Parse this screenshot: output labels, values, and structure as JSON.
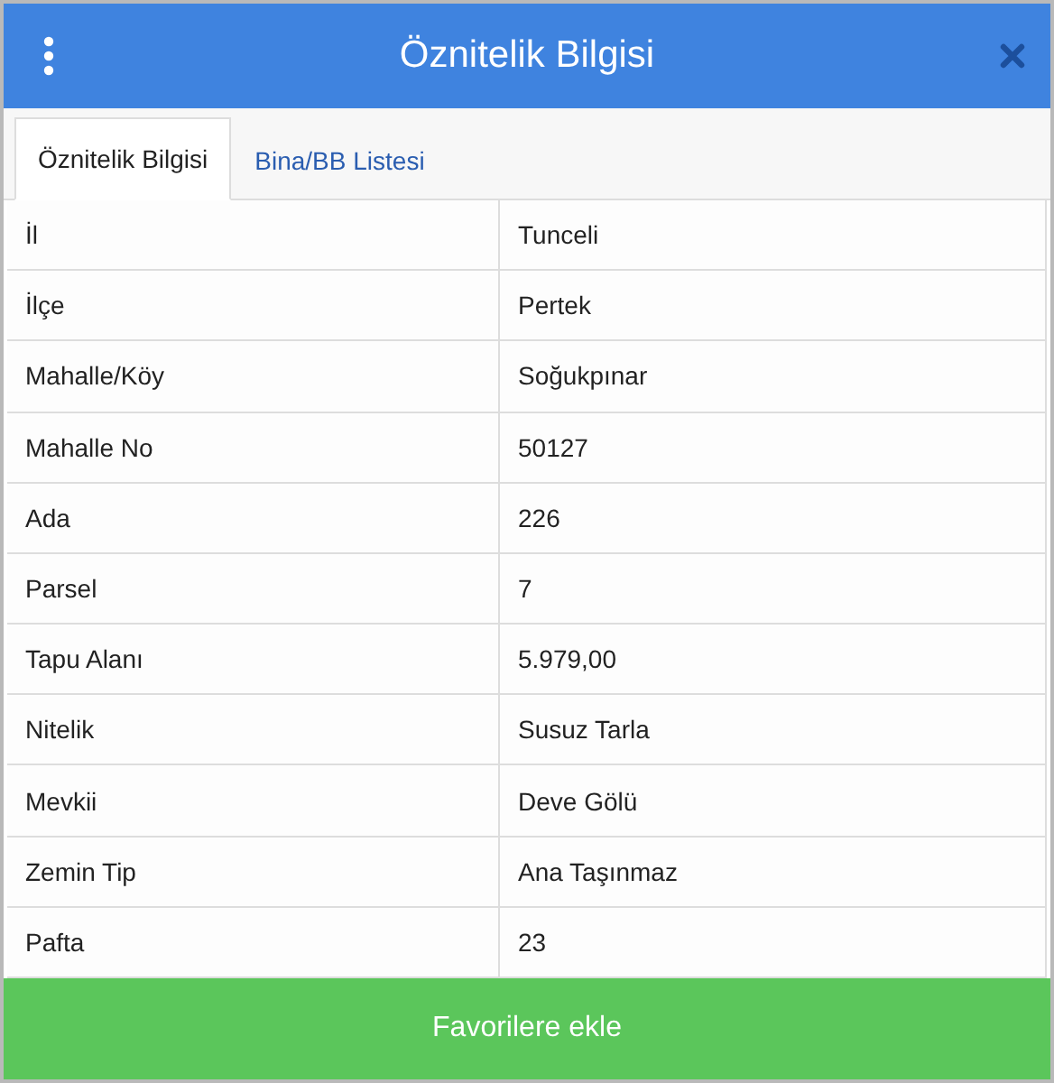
{
  "window": {
    "title": "Öznitelik Bilgisi"
  },
  "tabs": [
    {
      "label": "Öznitelik Bilgisi",
      "selected": true
    },
    {
      "label": "Bina/BB Listesi",
      "selected": false
    }
  ],
  "table": {
    "rows": [
      {
        "label": "İl",
        "value": "Tunceli"
      },
      {
        "label": "İlçe",
        "value": "Pertek"
      },
      {
        "label": "Mahalle/Köy",
        "value": "Soğukpınar"
      },
      {
        "label": "Mahalle No",
        "value": "50127"
      },
      {
        "label": "Ada",
        "value": "226"
      },
      {
        "label": "Parsel",
        "value": "7"
      },
      {
        "label": "Tapu Alanı",
        "value": "5.979,00"
      },
      {
        "label": "Nitelik",
        "value": "Susuz Tarla"
      },
      {
        "label": "Mevkii",
        "value": "Deve Gölü"
      },
      {
        "label": "Zemin Tip",
        "value": "Ana Taşınmaz"
      },
      {
        "label": "Pafta",
        "value": "23"
      }
    ]
  },
  "footer_button": {
    "label": "Favorilere ekle"
  }
}
